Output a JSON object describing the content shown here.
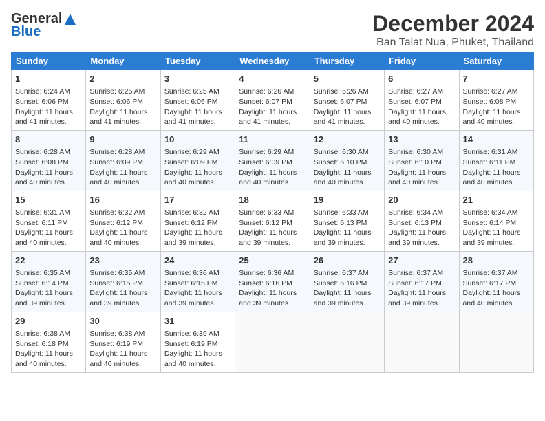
{
  "logo": {
    "general": "General",
    "blue": "Blue"
  },
  "title": {
    "month": "December 2024",
    "location": "Ban Talat Nua, Phuket, Thailand"
  },
  "weekdays": [
    "Sunday",
    "Monday",
    "Tuesday",
    "Wednesday",
    "Thursday",
    "Friday",
    "Saturday"
  ],
  "weeks": [
    [
      {
        "day": "1",
        "sunrise": "6:24 AM",
        "sunset": "6:06 PM",
        "daylight": "11 hours and 41 minutes."
      },
      {
        "day": "2",
        "sunrise": "6:25 AM",
        "sunset": "6:06 PM",
        "daylight": "11 hours and 41 minutes."
      },
      {
        "day": "3",
        "sunrise": "6:25 AM",
        "sunset": "6:06 PM",
        "daylight": "11 hours and 41 minutes."
      },
      {
        "day": "4",
        "sunrise": "6:26 AM",
        "sunset": "6:07 PM",
        "daylight": "11 hours and 41 minutes."
      },
      {
        "day": "5",
        "sunrise": "6:26 AM",
        "sunset": "6:07 PM",
        "daylight": "11 hours and 41 minutes."
      },
      {
        "day": "6",
        "sunrise": "6:27 AM",
        "sunset": "6:07 PM",
        "daylight": "11 hours and 40 minutes."
      },
      {
        "day": "7",
        "sunrise": "6:27 AM",
        "sunset": "6:08 PM",
        "daylight": "11 hours and 40 minutes."
      }
    ],
    [
      {
        "day": "8",
        "sunrise": "6:28 AM",
        "sunset": "6:08 PM",
        "daylight": "11 hours and 40 minutes."
      },
      {
        "day": "9",
        "sunrise": "6:28 AM",
        "sunset": "6:09 PM",
        "daylight": "11 hours and 40 minutes."
      },
      {
        "day": "10",
        "sunrise": "6:29 AM",
        "sunset": "6:09 PM",
        "daylight": "11 hours and 40 minutes."
      },
      {
        "day": "11",
        "sunrise": "6:29 AM",
        "sunset": "6:09 PM",
        "daylight": "11 hours and 40 minutes."
      },
      {
        "day": "12",
        "sunrise": "6:30 AM",
        "sunset": "6:10 PM",
        "daylight": "11 hours and 40 minutes."
      },
      {
        "day": "13",
        "sunrise": "6:30 AM",
        "sunset": "6:10 PM",
        "daylight": "11 hours and 40 minutes."
      },
      {
        "day": "14",
        "sunrise": "6:31 AM",
        "sunset": "6:11 PM",
        "daylight": "11 hours and 40 minutes."
      }
    ],
    [
      {
        "day": "15",
        "sunrise": "6:31 AM",
        "sunset": "6:11 PM",
        "daylight": "11 hours and 40 minutes."
      },
      {
        "day": "16",
        "sunrise": "6:32 AM",
        "sunset": "6:12 PM",
        "daylight": "11 hours and 40 minutes."
      },
      {
        "day": "17",
        "sunrise": "6:32 AM",
        "sunset": "6:12 PM",
        "daylight": "11 hours and 39 minutes."
      },
      {
        "day": "18",
        "sunrise": "6:33 AM",
        "sunset": "6:12 PM",
        "daylight": "11 hours and 39 minutes."
      },
      {
        "day": "19",
        "sunrise": "6:33 AM",
        "sunset": "6:13 PM",
        "daylight": "11 hours and 39 minutes."
      },
      {
        "day": "20",
        "sunrise": "6:34 AM",
        "sunset": "6:13 PM",
        "daylight": "11 hours and 39 minutes."
      },
      {
        "day": "21",
        "sunrise": "6:34 AM",
        "sunset": "6:14 PM",
        "daylight": "11 hours and 39 minutes."
      }
    ],
    [
      {
        "day": "22",
        "sunrise": "6:35 AM",
        "sunset": "6:14 PM",
        "daylight": "11 hours and 39 minutes."
      },
      {
        "day": "23",
        "sunrise": "6:35 AM",
        "sunset": "6:15 PM",
        "daylight": "11 hours and 39 minutes."
      },
      {
        "day": "24",
        "sunrise": "6:36 AM",
        "sunset": "6:15 PM",
        "daylight": "11 hours and 39 minutes."
      },
      {
        "day": "25",
        "sunrise": "6:36 AM",
        "sunset": "6:16 PM",
        "daylight": "11 hours and 39 minutes."
      },
      {
        "day": "26",
        "sunrise": "6:37 AM",
        "sunset": "6:16 PM",
        "daylight": "11 hours and 39 minutes."
      },
      {
        "day": "27",
        "sunrise": "6:37 AM",
        "sunset": "6:17 PM",
        "daylight": "11 hours and 39 minutes."
      },
      {
        "day": "28",
        "sunrise": "6:37 AM",
        "sunset": "6:17 PM",
        "daylight": "11 hours and 40 minutes."
      }
    ],
    [
      {
        "day": "29",
        "sunrise": "6:38 AM",
        "sunset": "6:18 PM",
        "daylight": "11 hours and 40 minutes."
      },
      {
        "day": "30",
        "sunrise": "6:38 AM",
        "sunset": "6:19 PM",
        "daylight": "11 hours and 40 minutes."
      },
      {
        "day": "31",
        "sunrise": "6:39 AM",
        "sunset": "6:19 PM",
        "daylight": "11 hours and 40 minutes."
      },
      null,
      null,
      null,
      null
    ]
  ]
}
